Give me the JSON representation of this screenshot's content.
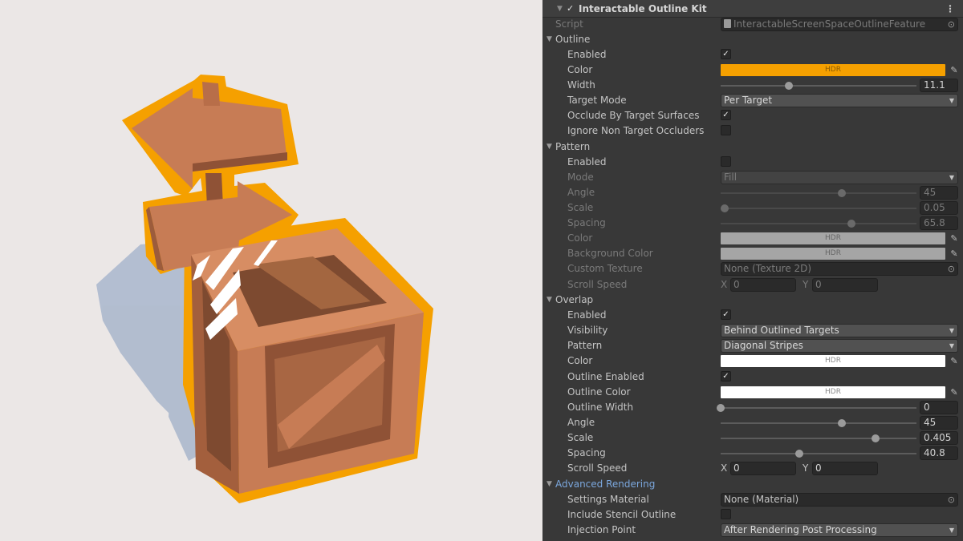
{
  "component": {
    "title": "Interactable Outline Kit",
    "enabled_mark": "✓",
    "menu_icon": "kebab-menu-icon"
  },
  "script": {
    "label": "Script",
    "value": "InteractableScreenSpaceOutlineFeature"
  },
  "outline": {
    "header": "Outline",
    "enabled": {
      "label": "Enabled",
      "checked": true
    },
    "color": {
      "label": "Color",
      "badge": "HDR",
      "hex": "#f5a000"
    },
    "width": {
      "label": "Width",
      "value": "11.1",
      "fraction": 0.35
    },
    "target_mode": {
      "label": "Target Mode",
      "value": "Per Target"
    },
    "occlude": {
      "label": "Occlude By Target Surfaces",
      "checked": true
    },
    "ignore": {
      "label": "Ignore Non Target Occluders",
      "checked": false
    }
  },
  "pattern": {
    "header": "Pattern",
    "enabled": {
      "label": "Enabled",
      "checked": false
    },
    "mode": {
      "label": "Mode",
      "value": "Fill"
    },
    "angle": {
      "label": "Angle",
      "value": "45",
      "fraction": 0.62
    },
    "scale": {
      "label": "Scale",
      "value": "0.05",
      "fraction": 0.02
    },
    "spacing": {
      "label": "Spacing",
      "value": "65.8",
      "fraction": 0.67
    },
    "color": {
      "label": "Color",
      "badge": "HDR",
      "hex": "#ffffff"
    },
    "bg_color": {
      "label": "Background Color",
      "badge": "HDR",
      "hex": "#ffffff"
    },
    "texture": {
      "label": "Custom Texture",
      "value": "None (Texture 2D)"
    },
    "scroll": {
      "label": "Scroll Speed",
      "x_label": "X",
      "x": "0",
      "y_label": "Y",
      "y": "0"
    }
  },
  "overlay": {
    "header": "Overlap",
    "enabled": {
      "label": "Enabled",
      "checked": true
    },
    "visibility": {
      "label": "Visibility",
      "value": "Behind Outlined Targets"
    },
    "pattern": {
      "label": "Pattern",
      "value": "Diagonal Stripes"
    },
    "color": {
      "label": "Color",
      "badge": "HDR",
      "hex": "#ffffff"
    },
    "outline_enabled": {
      "label": "Outline Enabled",
      "checked": true
    },
    "outline_color": {
      "label": "Outline Color",
      "badge": "HDR",
      "hex": "#ffffff"
    },
    "outline_width": {
      "label": "Outline Width",
      "value": "0",
      "fraction": 0.0
    },
    "angle": {
      "label": "Angle",
      "value": "45",
      "fraction": 0.62
    },
    "scale": {
      "label": "Scale",
      "value": "0.405",
      "fraction": 0.79
    },
    "spacing": {
      "label": "Spacing",
      "value": "40.8",
      "fraction": 0.4
    },
    "scroll": {
      "label": "Scroll Speed",
      "x_label": "X",
      "x": "0",
      "y_label": "Y",
      "y": "0"
    }
  },
  "advanced": {
    "header": "Advanced Rendering",
    "material": {
      "label": "Settings Material",
      "value": "None (Material)"
    },
    "stencil": {
      "label": "Include Stencil Outline",
      "checked": false
    },
    "injection": {
      "label": "Injection Point",
      "value": "After Rendering Post Processing"
    }
  },
  "scene": {
    "background": "#ebe7e6",
    "wood": "#c77c55",
    "wood_dark": "#8f5236",
    "outline_color": "#f5a000",
    "shadow": "#a9b6cc"
  }
}
